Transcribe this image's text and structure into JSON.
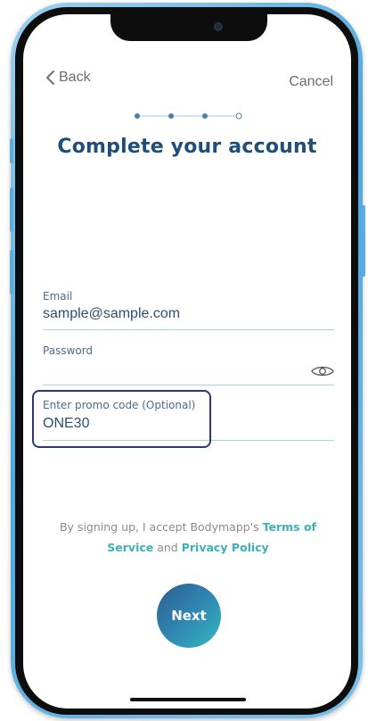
{
  "nav": {
    "back_label": "Back",
    "cancel_label": "Cancel"
  },
  "stepper": {
    "total_steps": 4,
    "current_step": 3
  },
  "title": "Complete your account",
  "form": {
    "email": {
      "label": "Email",
      "value": "sample@sample.com"
    },
    "password": {
      "label": "Password",
      "value": ""
    },
    "promo": {
      "label": "Enter promo code (Optional)",
      "value": "ONE30"
    }
  },
  "terms": {
    "prefix": "By signing up, I accept Bodymapp's ",
    "terms_link": "Terms of Service",
    "joiner": " and ",
    "privacy_link": "Privacy Policy"
  },
  "next_label": "Next",
  "colors": {
    "title": "#1f4e79",
    "link": "#3bb0b8",
    "highlight_border": "#2a3a78",
    "field_underline": "#a9d4e0"
  },
  "icons": [
    "chevron-left-icon",
    "eye-icon"
  ]
}
